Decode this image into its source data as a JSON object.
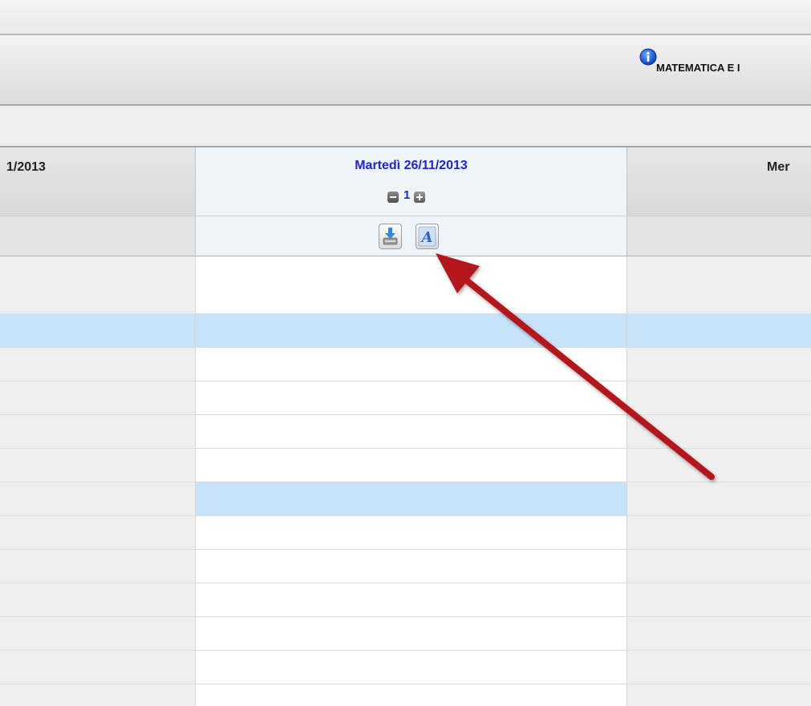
{
  "header": {
    "subject": "MATEMATICA E I",
    "info_icon": "info-icon"
  },
  "columns": [
    {
      "date": "1/2013"
    },
    {
      "date": "Martedì 26/11/2013",
      "lesson_count": "1"
    },
    {
      "date": "Mer"
    }
  ],
  "toolbar": {
    "import_icon": "import-download-icon",
    "format_icon": "text-format-icon"
  },
  "colors": {
    "date_link": "#1d24e0",
    "row_highlight": "#c6e3fa",
    "arrow": "#b4161c"
  }
}
